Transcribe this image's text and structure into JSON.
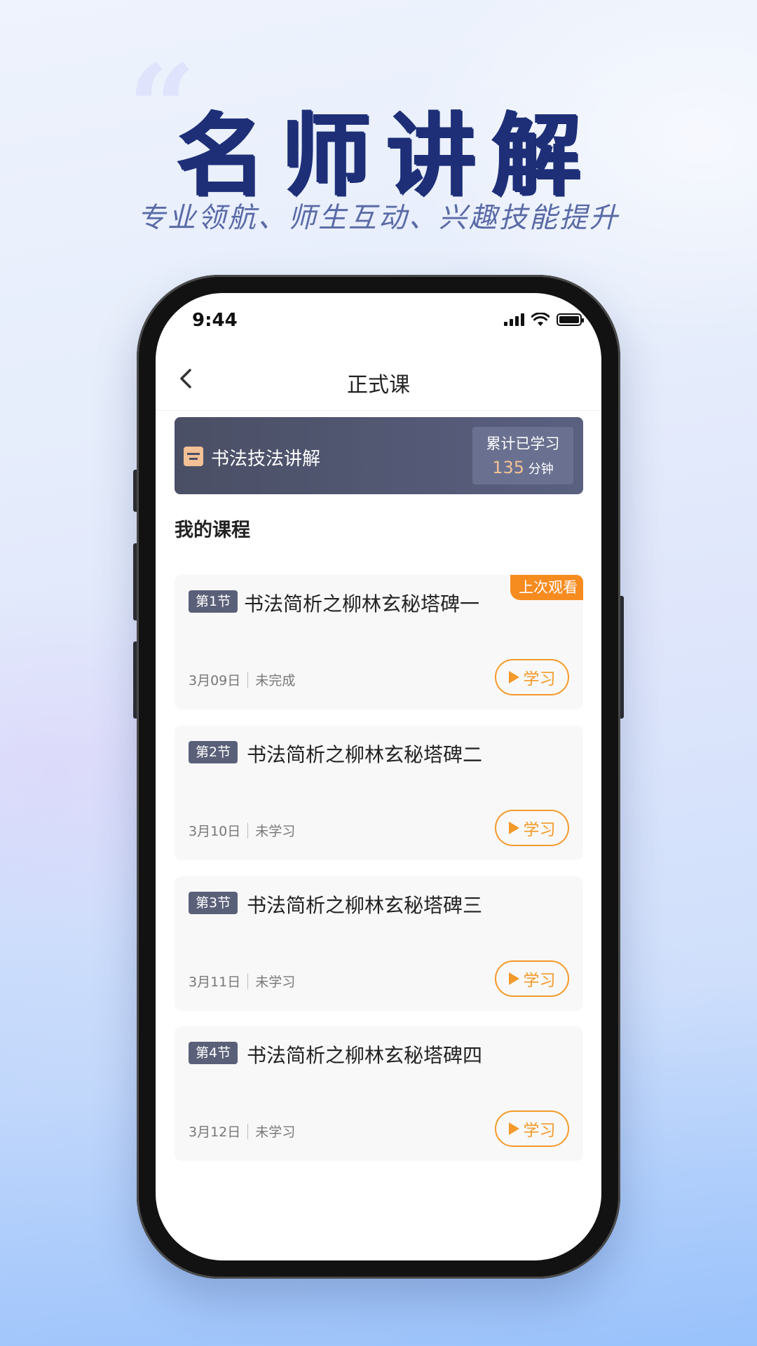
{
  "hero": {
    "quote_mark": "“",
    "headline": "名师讲解",
    "subheadline": "专业领航、师生互动、兴趣技能提升"
  },
  "status_bar": {
    "time": "9:44"
  },
  "nav": {
    "title": "正式课"
  },
  "banner": {
    "course_name": "书法技法讲解",
    "stat_label": "累计已学习",
    "stat_value": "135",
    "stat_unit": "分钟"
  },
  "section": {
    "title": "我的课程"
  },
  "lessons": [
    {
      "tag": "第1节",
      "title": "书法简析之柳林玄秘塔碑一",
      "date": "3月09日",
      "status": "未完成",
      "button": "学习",
      "badge": "上次观看"
    },
    {
      "tag": "第2节",
      "title": "书法简析之柳林玄秘塔碑二",
      "date": "3月10日",
      "status": "未学习",
      "button": "学习"
    },
    {
      "tag": "第3节",
      "title": "书法简析之柳林玄秘塔碑三",
      "date": "3月11日",
      "status": "未学习",
      "button": "学习"
    },
    {
      "tag": "第4节",
      "title": "书法简析之柳林玄秘塔碑四",
      "date": "3月12日",
      "status": "未学习",
      "button": "学习"
    }
  ],
  "colors": {
    "headline": "#1e2f78",
    "accent_orange": "#f39a2a",
    "badge_orange": "#f68b1f",
    "banner_bg": "#4a4f65",
    "tag_bg": "#5b6079"
  },
  "icons": {
    "back": "chevron-left-icon",
    "banner": "book-box-icon",
    "signal": "cellular-signal-icon",
    "wifi": "wifi-icon",
    "battery": "battery-icon",
    "play": "play-icon"
  }
}
